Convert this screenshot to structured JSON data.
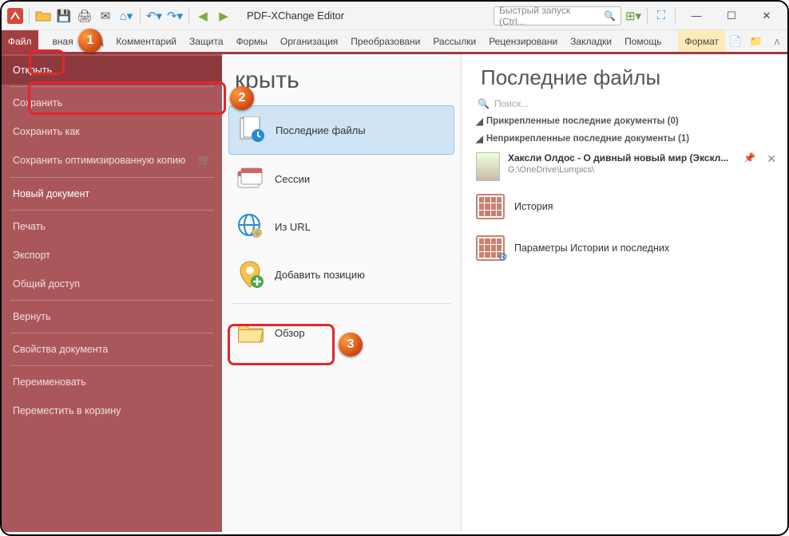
{
  "app": {
    "title": "PDF-XChange Editor"
  },
  "quick_launch": {
    "placeholder": "Быстрый запуск (Ctrl..."
  },
  "tabs": {
    "file": "Файл",
    "home_partial": "вная",
    "view": "Вид",
    "comments": "Комментарий",
    "protect": "Защита",
    "forms": "Формы",
    "organize": "Организация",
    "convert": "Преобразовани",
    "mail": "Рассылки",
    "review": "Рецензировани",
    "bookmarks": "Закладки",
    "help": "Помощь",
    "format": "Формат"
  },
  "sidebar": {
    "open": "Открыть",
    "save": "Сохранить",
    "save_as": "Сохранить как",
    "save_opt": "Сохранить оптимизированную копию",
    "new_doc": "Новый документ",
    "print": "Печать",
    "export": "Экспорт",
    "share": "Общий доступ",
    "revert": "Вернуть",
    "props": "Свойства документа",
    "rename": "Переименовать",
    "trash": "Переместить в корзину"
  },
  "mid": {
    "heading_partial": "крыть",
    "recent": "Последние файлы",
    "sessions": "Сессии",
    "from_url": "Из URL",
    "add_place": "Добавить позицию",
    "browse": "Обзор"
  },
  "recent": {
    "heading": "Последние файлы",
    "search_placeholder": "Поиск...",
    "pinned_label": "Прикрепленные последние документы (0)",
    "unpinned_label": "Неприкрепленные последние документы (1)",
    "doc1_name": "Хаксли Олдос - О дивный новый мир (Экскл...",
    "doc1_path": "G:\\OneDrive\\Lumpics\\",
    "history": "История",
    "params": "Параметры Истории и последних"
  },
  "callouts": {
    "c1": "1",
    "c2": "2",
    "c3": "3"
  }
}
